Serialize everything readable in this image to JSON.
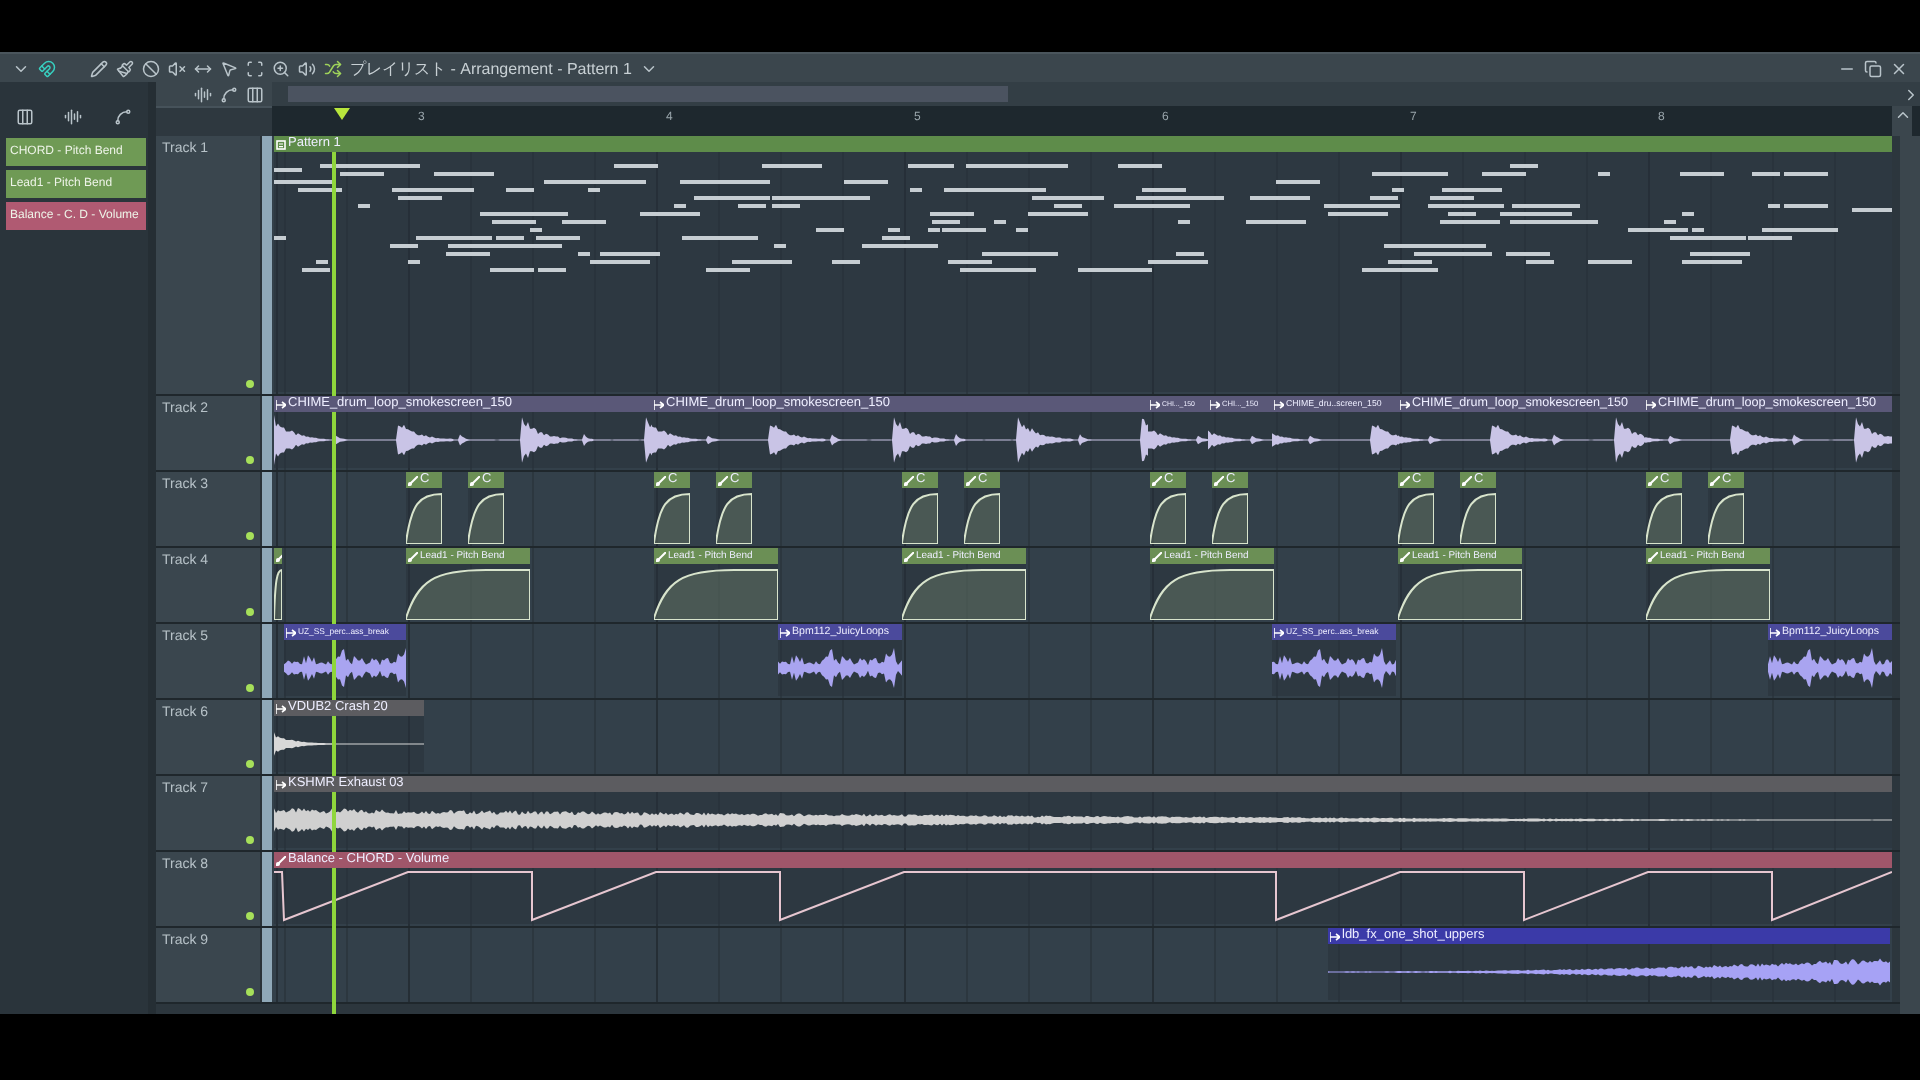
{
  "window": {
    "title": "プレイリスト - Arrangement - Pattern 1"
  },
  "browser": {
    "items": [
      {
        "label": "CHORD - Pitch Bend",
        "color": "#6f9a55"
      },
      {
        "label": "Lead1 - Pitch Bend",
        "color": "#6f9a55"
      },
      {
        "label": "Balance - C. D - Volume",
        "color": "#b05a72"
      }
    ]
  },
  "ruler": {
    "bars": [
      "3",
      "4",
      "5",
      "6",
      "7",
      "8"
    ]
  },
  "tracks": [
    {
      "name": "Track 1",
      "enabled": true,
      "color": "#5e8c4a",
      "clips": [
        {
          "kind": "pattern",
          "label": "Pattern 1"
        }
      ]
    },
    {
      "name": "Track 2",
      "enabled": true,
      "color": "#5a5878",
      "clips": [
        {
          "kind": "audio",
          "label": "CHIME_drum_loop_smokescreen_150"
        },
        {
          "kind": "audio",
          "label": "CHIME_drum_loop_smokescreen_150"
        },
        {
          "kind": "audio",
          "label": "CHI..._150"
        },
        {
          "kind": "audio",
          "label": "CHI..._150"
        },
        {
          "kind": "audio",
          "label": "CHIME_dru..screen_150"
        },
        {
          "kind": "audio",
          "label": "CHIME_drum_loop_smokescreen_150"
        },
        {
          "kind": "audio",
          "label": "CHIME_drum_loop_smokescreen_150"
        }
      ]
    },
    {
      "name": "Track 3",
      "enabled": true,
      "color": "#6b8f55",
      "clips": [
        {
          "kind": "automation",
          "label": "C"
        },
        {
          "kind": "automation",
          "label": "C"
        },
        {
          "kind": "automation",
          "label": "C"
        },
        {
          "kind": "automation",
          "label": "C"
        },
        {
          "kind": "automation",
          "label": "C"
        },
        {
          "kind": "automation",
          "label": "C"
        },
        {
          "kind": "automation",
          "label": "C"
        },
        {
          "kind": "automation",
          "label": "C"
        },
        {
          "kind": "automation",
          "label": "C"
        },
        {
          "kind": "automation",
          "label": "C"
        },
        {
          "kind": "automation",
          "label": "C"
        },
        {
          "kind": "automation",
          "label": "C"
        }
      ]
    },
    {
      "name": "Track 4",
      "enabled": true,
      "color": "#6b8f55",
      "clips": [
        {
          "kind": "automation"
        },
        {
          "kind": "automation",
          "label": "Lead1 - Pitch Bend"
        },
        {
          "kind": "automation",
          "label": "Lead1 - Pitch Bend"
        },
        {
          "kind": "automation",
          "label": "Lead1 - Pitch Bend"
        },
        {
          "kind": "automation",
          "label": "Lead1 - Pitch Bend"
        },
        {
          "kind": "automation",
          "label": "Lead1 - Pitch Bend"
        },
        {
          "kind": "automation",
          "label": "Lead1 - Pitch Bend"
        }
      ]
    },
    {
      "name": "Track 5",
      "enabled": true,
      "color": "#4b4a9c",
      "clips": [
        {
          "kind": "audio",
          "label": "UZ_SS_perc..ass_break"
        },
        {
          "kind": "audio",
          "label": "Bpm112_JuicyLoops"
        },
        {
          "kind": "audio",
          "label": "UZ_SS_perc..ass_break"
        },
        {
          "kind": "audio",
          "label": "Bpm112_JuicyLoops"
        }
      ]
    },
    {
      "name": "Track 6",
      "enabled": true,
      "color": "#5c5c60",
      "clips": [
        {
          "kind": "audio",
          "label": "VDUB2 Crash 20"
        }
      ]
    },
    {
      "name": "Track 7",
      "enabled": true,
      "color": "#5c5c60",
      "clips": [
        {
          "kind": "audio",
          "label": "KSHMR Exhaust 03"
        }
      ]
    },
    {
      "name": "Track 8",
      "enabled": true,
      "color": "#a0566a",
      "clips": [
        {
          "kind": "automation",
          "label": "Balance - CHORD - Volume"
        }
      ]
    },
    {
      "name": "Track 9",
      "enabled": true,
      "color": "#3b3aa8",
      "clips": [
        {
          "kind": "audio",
          "label": "ldb_fx_one_shot_uppers"
        }
      ]
    }
  ]
}
